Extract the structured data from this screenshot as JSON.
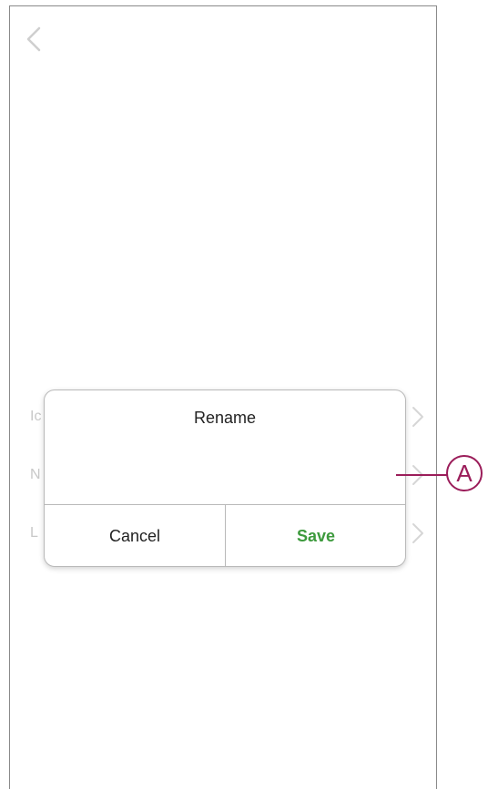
{
  "header": {
    "back_icon": "chevron-left-icon"
  },
  "background_rows": [
    {
      "label": "Ic",
      "chevron": "chevron-right-icon"
    },
    {
      "label": "N",
      "chevron": "chevron-right-icon"
    },
    {
      "label": "L",
      "chevron": "chevron-right-icon"
    }
  ],
  "dialog": {
    "title": "Rename",
    "input_value": "",
    "cancel_label": "Cancel",
    "save_label": "Save"
  },
  "callout": {
    "label": "A",
    "color": "#9b1d5a"
  },
  "colors": {
    "save": "#3d9a3d",
    "border": "#b9b9b9",
    "muted_text": "#c8c8c8"
  }
}
